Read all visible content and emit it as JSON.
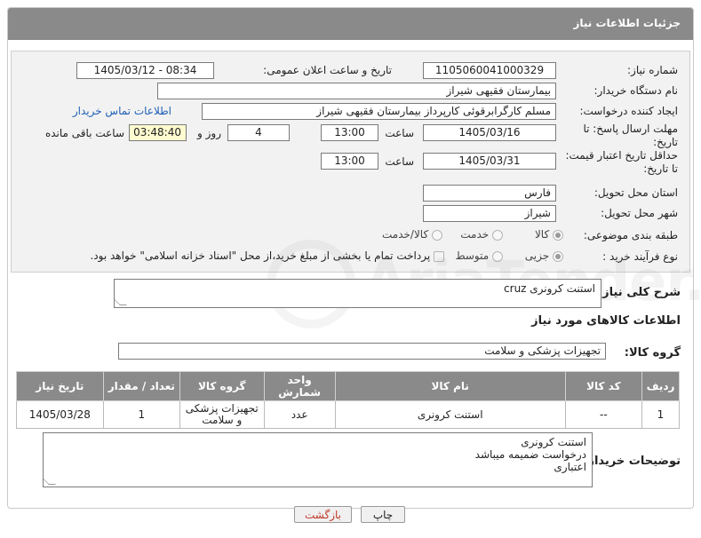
{
  "header": {
    "title": "جزئیات اطلاعات نیاز"
  },
  "form": {
    "need_number_label": "شماره نیاز:",
    "need_number": "1105060041000329",
    "announce_label": "تاریخ و ساعت اعلان عمومی:",
    "announce_value": "1405/03/12 - 08:34",
    "buyer_org_label": "نام دستگاه خریدار:",
    "buyer_org": "بیمارستان فقیهی شیراز",
    "requester_label": "ایجاد کننده درخواست:",
    "requester": "مسلم کارگرابرقوئی کارپرداز  بیمارستان فقیهی شیراز",
    "contact_link": "اطلاعات تماس خریدار",
    "deadline_label": "مهلت ارسال پاسخ: تا تاریخ:",
    "deadline_date": "1405/03/16",
    "time_label": "ساعت",
    "deadline_time": "13:00",
    "days_value": "4",
    "days_label": "روز و",
    "remaining_time": "03:48:40",
    "remaining_label": "ساعت باقی مانده",
    "validity_label": "حداقل تاریخ اعتبار قیمت: تا تاریخ:",
    "validity_date": "1405/03/31",
    "validity_time": "13:00",
    "province_label": "استان محل تحویل:",
    "province": "فارس",
    "city_label": "شهر محل تحویل:",
    "city": "شیراز",
    "category_label": "طبقه بندی موضوعی:",
    "category_options": [
      "کالا",
      "خدمت",
      "کالا/خدمت"
    ],
    "category_selected": "کالا",
    "process_label": "نوع فرآیند خرید :",
    "process_options": [
      "جزیی",
      "متوسط"
    ],
    "process_selected": "جزیی",
    "payment_note": "پرداخت تمام یا بخشی از مبلغ خرید،از محل \"اسناد خزانه اسلامی\" خواهد بود."
  },
  "summary": {
    "label": "شرح کلی نیاز:",
    "value": "استنت کرونری cruz"
  },
  "goods_section": {
    "title": "اطلاعات کالاهای مورد نیاز",
    "group_label": "گروه کالا:",
    "group_value": "تجهیزات پزشکی و سلامت"
  },
  "table": {
    "headers": [
      "ردیف",
      "کد کالا",
      "نام کالا",
      "واحد شمارش",
      "گروه کالا",
      "تعداد / مقدار",
      "تاریخ نیاز"
    ],
    "rows": [
      [
        "1",
        "--",
        "استنت کرونری",
        "عدد",
        "تجهیزات پزشکی و سلامت",
        "1",
        "1405/03/28"
      ]
    ]
  },
  "buyer_notes": {
    "label": "توضیحات خریدار:",
    "lines": [
      "استنت کرونری",
      "درخواست ضمیمه میباشد",
      "اعتباری"
    ]
  },
  "buttons": {
    "print": "چاپ",
    "back": "بازگشت"
  },
  "watermark": {
    "text": "AriaTender.net"
  },
  "colors": {
    "header_bg": "#8a8a8a",
    "link": "#1f5fb5",
    "back_text": "#c0392b",
    "remaining_bg": "#fffbd0"
  }
}
